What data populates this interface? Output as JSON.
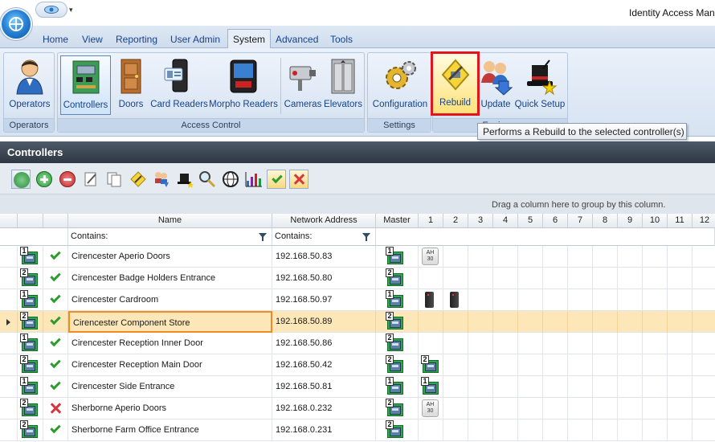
{
  "window": {
    "title": "Identity Access Mana"
  },
  "ribbon_tabs": [
    {
      "label": "Home"
    },
    {
      "label": "View"
    },
    {
      "label": "Reporting"
    },
    {
      "label": "User Admin"
    },
    {
      "label": "System",
      "active": true
    },
    {
      "label": "Advanced"
    },
    {
      "label": "Tools"
    }
  ],
  "ribbon_groups": {
    "operators": {
      "label": "Operators",
      "buttons": [
        "Operators"
      ]
    },
    "access_control": {
      "label": "Access Control",
      "buttons": [
        "Controllers",
        "Doors",
        "Card Readers",
        "Morpho Readers",
        "Cameras",
        "Elevators"
      ]
    },
    "settings": {
      "label": "Settings",
      "buttons": [
        "Configuration"
      ]
    },
    "engineer": {
      "label": "Engineer",
      "buttons": [
        "Rebuild",
        "Update",
        "Quick Setup"
      ]
    }
  },
  "tooltip": "Performs a Rebuild to the selected controller(s)",
  "panel": {
    "title": "Controllers"
  },
  "toolbar_icons": [
    "refresh-icon",
    "add-icon",
    "remove-icon",
    "edit-icon",
    "copy-icon",
    "rebuild-icon",
    "update-icon",
    "quick-setup-icon",
    "search-icon",
    "network-icon",
    "chart-icon",
    "accept-icon",
    "reject-icon"
  ],
  "groupby_hint": "Drag a column here to group by this column.",
  "grid": {
    "columns": {
      "name": "Name",
      "address": "Network Address",
      "master": "Master",
      "slots": [
        "1",
        "2",
        "3",
        "4",
        "5",
        "6",
        "7",
        "8",
        "9",
        "10",
        "11",
        "12"
      ]
    },
    "filter_label": "Contains:",
    "rows": [
      {
        "slot_num": "1",
        "status": "ok",
        "name": "Cirencester Aperio Doors",
        "address": "192.168.50.83",
        "master_num": "1",
        "c1": "ah30",
        "c2": ""
      },
      {
        "slot_num": "2",
        "status": "ok",
        "name": "Cirencester Badge Holders Entrance",
        "address": "192.168.50.80",
        "master_num": "2",
        "c1": "",
        "c2": ""
      },
      {
        "slot_num": "1",
        "status": "ok",
        "name": "Cirencester Cardroom",
        "address": "192.168.50.97",
        "master_num": "1",
        "c1": "reader",
        "c2": "reader"
      },
      {
        "slot_num": "2",
        "status": "ok",
        "name": "Cirencester Component Store",
        "address": "192.168.50.89",
        "master_num": "2",
        "c1": "",
        "c2": "",
        "selected": true
      },
      {
        "slot_num": "1",
        "status": "ok",
        "name": "Cirencester Reception Inner Door",
        "address": "192.168.50.86",
        "master_num": "2",
        "c1": "",
        "c2": ""
      },
      {
        "slot_num": "2",
        "status": "ok",
        "name": "Cirencester Reception Main Door",
        "address": "192.168.50.42",
        "master_num": "2",
        "c1": "ctrl2",
        "c2": ""
      },
      {
        "slot_num": "1",
        "status": "ok",
        "name": "Cirencester Side Entrance",
        "address": "192.168.50.81",
        "master_num": "1",
        "c1": "ctrl1",
        "c2": ""
      },
      {
        "slot_num": "2",
        "status": "error",
        "name": "Sherborne Aperio Doors",
        "address": "192.168.0.232",
        "master_num": "2",
        "c1": "ah30",
        "c2": ""
      },
      {
        "slot_num": "2",
        "status": "ok",
        "name": "Sherborne Farm Office Entrance",
        "address": "192.168.0.231",
        "master_num": "2",
        "c1": "",
        "c2": ""
      }
    ]
  },
  "badges": {
    "ah30_line1": "AH",
    "ah30_line2": "30"
  },
  "colors": {
    "highlight_outline": "#e0151f",
    "selected_row": "#fde7b8",
    "ok": "#2d9c2d",
    "error": "#d9363e"
  }
}
